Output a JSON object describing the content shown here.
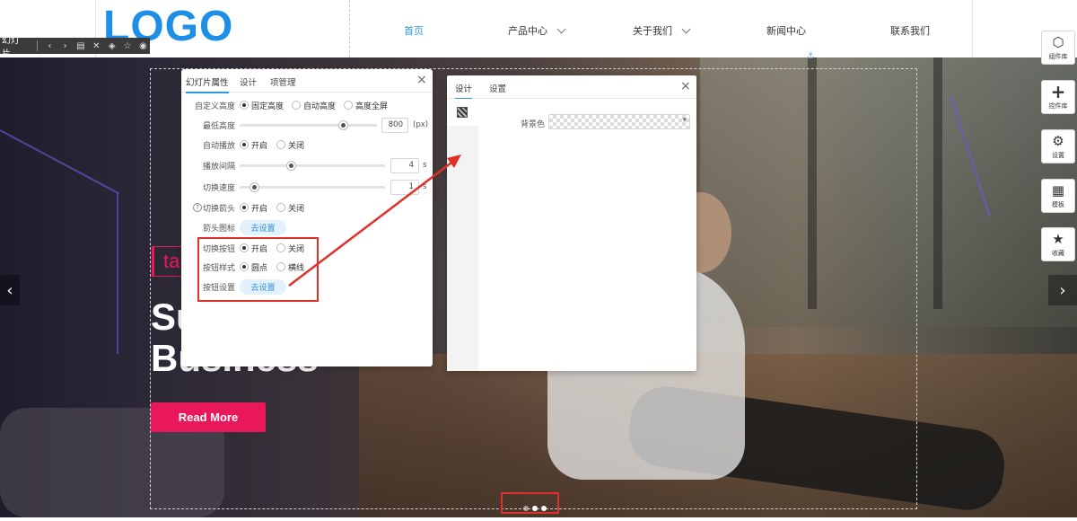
{
  "header": {
    "logo_text": "LOGO",
    "nav": [
      {
        "label": "首页",
        "active": true,
        "has_dropdown": false
      },
      {
        "label": "产品中心",
        "active": false,
        "has_dropdown": true
      },
      {
        "label": "关于我们",
        "active": false,
        "has_dropdown": true
      },
      {
        "label": "新闻中心",
        "active": false,
        "has_dropdown": false
      },
      {
        "label": "联系我们",
        "active": false,
        "has_dropdown": false
      }
    ]
  },
  "breadcrumb": {
    "label": "幻灯片",
    "icons": [
      "chevron-left-icon",
      "chevron-right-icon",
      "settings-doc-icon",
      "tools-icon",
      "layers-icon",
      "star-icon",
      "eye-icon"
    ]
  },
  "hero": {
    "tag_text": "tal",
    "headline_line1": "Su",
    "headline_line2": "Business",
    "read_more": "Read More",
    "prev_arrow": "‹",
    "next_arrow": "›",
    "dots": [
      false,
      true,
      true
    ]
  },
  "rail": [
    {
      "label": "组件库",
      "icon": "cube-icon"
    },
    {
      "label": "控件库",
      "icon": "plus-icon"
    },
    {
      "label": "设置",
      "icon": "gears-icon"
    },
    {
      "label": "模板",
      "icon": "grid-icon"
    },
    {
      "label": "收藏",
      "icon": "star-plus-icon"
    }
  ],
  "panel_slideshow": {
    "tabs": [
      "幻灯片属性",
      "设计",
      "项管理"
    ],
    "active_tab": 0,
    "close": "×",
    "custom_height": {
      "label": "自定义高度",
      "options": [
        "固定高度",
        "自动高度",
        "高度全屏"
      ],
      "selected": 0
    },
    "min_height": {
      "label": "最低高度",
      "value": "800",
      "unit": "(px)",
      "fraction": 0.75
    },
    "autoplay": {
      "label": "自动播放",
      "options": [
        "开启",
        "关闭"
      ],
      "selected": 0
    },
    "interval": {
      "label": "播放间隔",
      "value": "4",
      "unit": "s",
      "fraction": 0.35
    },
    "speed": {
      "label": "切换速度",
      "value": "1",
      "unit": "s",
      "fraction": 0.1
    },
    "arrows": {
      "label": "切换箭头",
      "options": [
        "开启",
        "关闭"
      ],
      "selected": 0
    },
    "arrow_icon": {
      "label": "箭头图标",
      "button": "去设置"
    },
    "switch_buttons": {
      "label": "切换按钮",
      "options": [
        "开启",
        "关闭"
      ],
      "selected": 0
    },
    "button_style": {
      "label": "按钮样式",
      "options": [
        "圆点",
        "横线"
      ],
      "selected": 0
    },
    "button_settings": {
      "label": "按钮设置",
      "button": "去设置"
    }
  },
  "panel_design": {
    "tabs": [
      "设计",
      "设置"
    ],
    "active_tab": 0,
    "close": "×",
    "background_color_label": "背景色",
    "background_color": "transparent"
  },
  "colors": {
    "accent_blue": "#2b9ae8",
    "brand_pink": "#e8185a",
    "highlight_red": "#e0302a",
    "logo_blue": "#1e8fe6"
  }
}
